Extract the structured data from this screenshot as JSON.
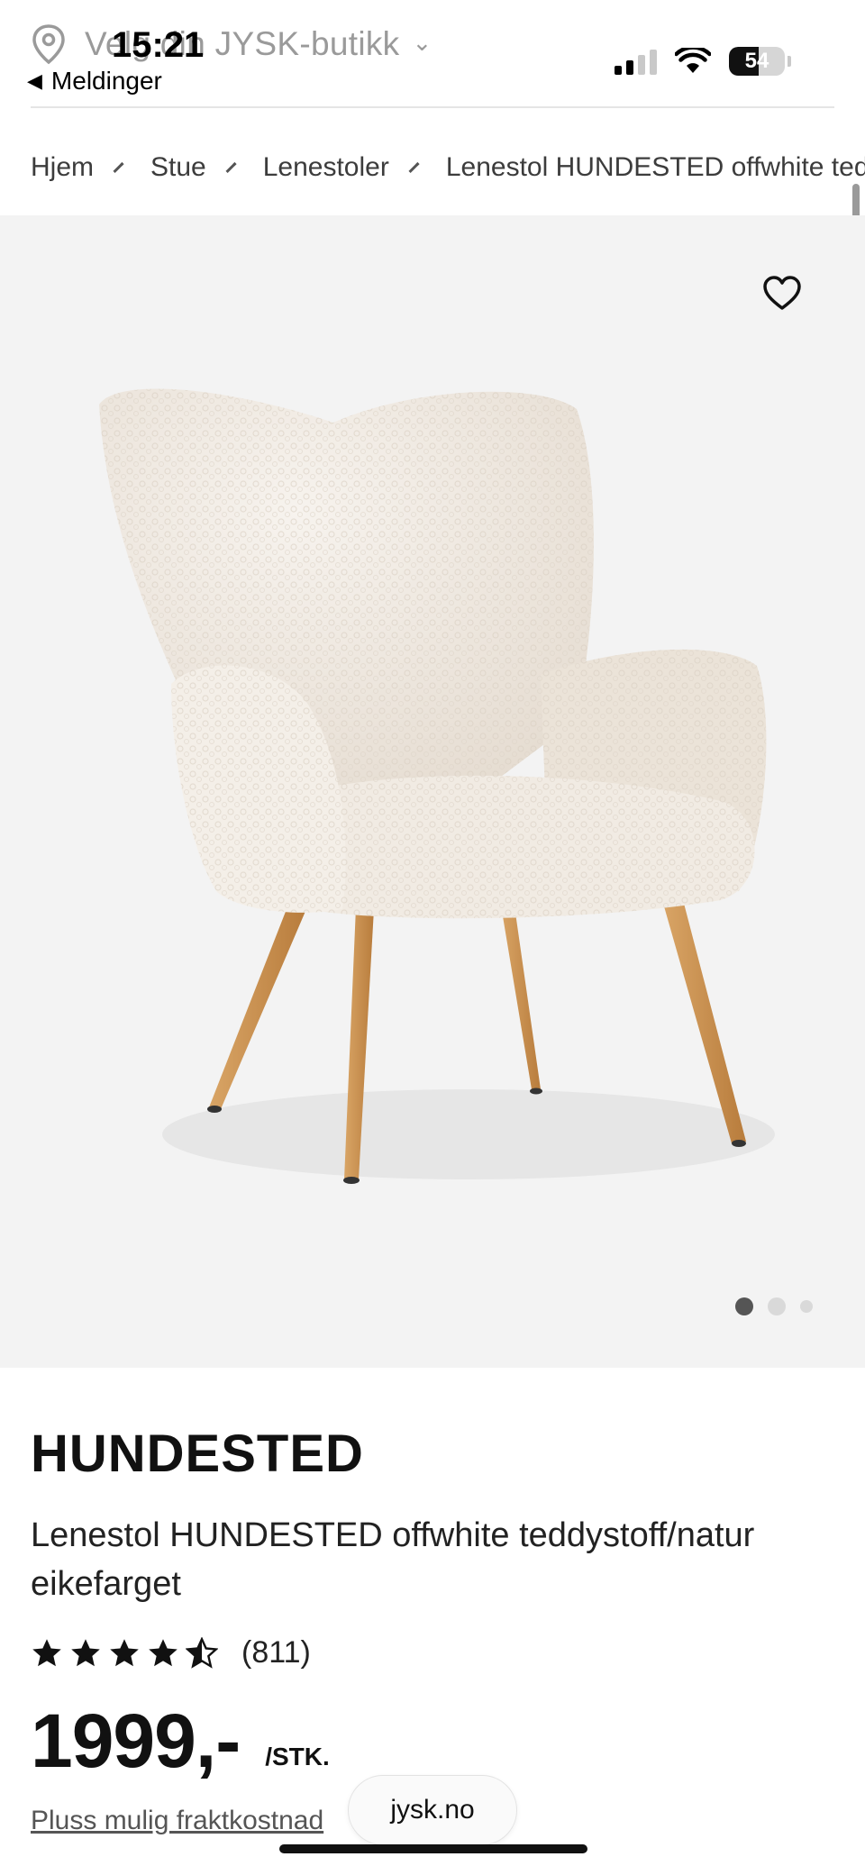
{
  "status_bar": {
    "time": "15:21",
    "back_label": "Meldinger",
    "battery": "54",
    "battery_level": 0.54
  },
  "store_selector": {
    "label": "Velg din JYSK-butikk"
  },
  "breadcrumb": {
    "items": [
      "Hjem",
      "Stue",
      "Lenestoler",
      "Lenestol HUNDESTED offwhite teddystoff/natur eikefarget"
    ]
  },
  "gallery": {
    "slides_total": 3,
    "active_slide": 1
  },
  "product": {
    "brand": "HUNDESTED",
    "description": "Lenestol HUNDESTED offwhite teddystoff/natur eikefarget",
    "rating": 4.5,
    "rating_count": "(811)",
    "price": "1999,-",
    "unit": "/STK.",
    "shipping_note": "Pluss mulig fraktkostnad"
  },
  "browser": {
    "url": "jysk.no"
  },
  "colors": {
    "gallery_bg": "#f3f3f3",
    "fabric": "#efe9e1",
    "legs": "#c8914f"
  }
}
